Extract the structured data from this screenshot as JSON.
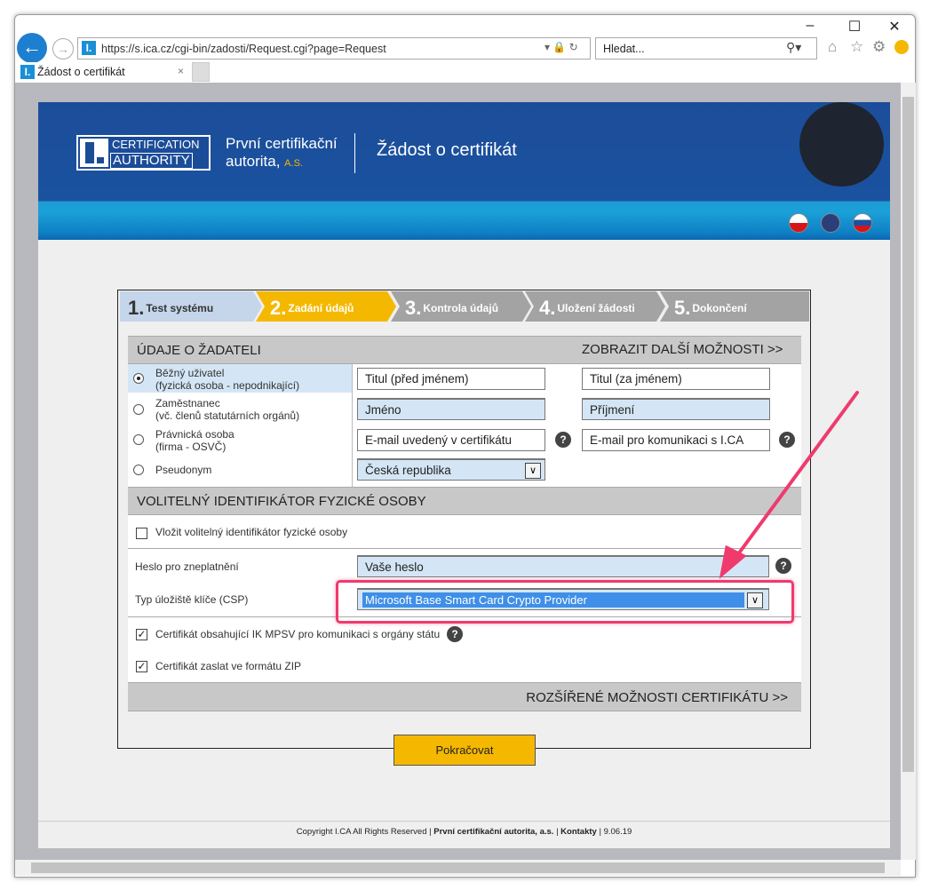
{
  "browser": {
    "url": "https://s.ica.cz/cgi-bin/zadosti/Request.cgi?page=Request",
    "search_placeholder": "Hledat...",
    "tab_title": "Žádost o certifikát",
    "favicon": "I."
  },
  "banner": {
    "logo_line1": "CERTIFICATION",
    "logo_line2": "AUTHORITY",
    "company_line1": "První certifikační",
    "company_line2": "autorita,",
    "company_suffix": "A.S.",
    "title": "Žádost o certifikát",
    "languages": [
      "cs",
      "en",
      "sk"
    ]
  },
  "steps": [
    {
      "num": "1.",
      "label": "Test systému"
    },
    {
      "num": "2.",
      "label": "Zadání údajů"
    },
    {
      "num": "3.",
      "label": "Kontrola údajů"
    },
    {
      "num": "4.",
      "label": "Uložení žádosti"
    },
    {
      "num": "5.",
      "label": "Dokončení"
    }
  ],
  "applicant": {
    "heading": "ÚDAJE O ŽADATELI",
    "more": "ZOBRAZIT DALŠÍ MOŽNOSTI >>",
    "types": [
      {
        "line1": "Běžný uživatel",
        "line2": "(fyzická osoba - nepodnikající)",
        "selected": true
      },
      {
        "line1": "Zaměstnanec",
        "line2": "(vč. členů statutárních orgánů)",
        "selected": false
      },
      {
        "line1": "Právnická osoba",
        "line2": "(firma - OSVČ)",
        "selected": false
      },
      {
        "line1": "Pseudonym",
        "line2": "",
        "selected": false
      }
    ],
    "title_before": "Titul (před jménem)",
    "title_after": "Titul (za jménem)",
    "first_name": "Jméno",
    "last_name": "Příjmení",
    "email_cert": "E-mail uvedený v certifikátu",
    "email_contact": "E-mail pro komunikaci s I.CA",
    "country": "Česká republika"
  },
  "optional": {
    "heading": "VOLITELNÝ IDENTIFIKÁTOR FYZICKÉ OSOBY",
    "checkbox_label": "Vložit volitelný identifikátor fyzické osoby",
    "checked": false
  },
  "password_label": "Heslo pro zneplatnění",
  "password_placeholder": "Vaše heslo",
  "csp_label": "Typ úložiště klíče (CSP)",
  "csp_value": "Microsoft Base Smart Card Crypto Provider",
  "mpsv_label": "Certifikát obsahující IK MPSV pro komunikaci s orgány státu",
  "mpsv_checked": true,
  "zip_label": "Certifikát zaslat ve formátu ZIP",
  "zip_checked": true,
  "advanced": "ROZŠÍŘENÉ MOŽNOSTI CERTIFIKÁTU >>",
  "continue": "Pokračovat",
  "footer": {
    "copyright": "Copyright I.CA All Rights Reserved |",
    "company_link": "První certifikační autorita, a.s.",
    "sep": "|",
    "contacts": "Kontakty",
    "date": "| 9.06.19"
  },
  "colors": {
    "annotation": "#ef3a6e",
    "step_active": "#f5b800",
    "step_done": "#c5d5ea",
    "step_todo": "#a3a3a3"
  }
}
